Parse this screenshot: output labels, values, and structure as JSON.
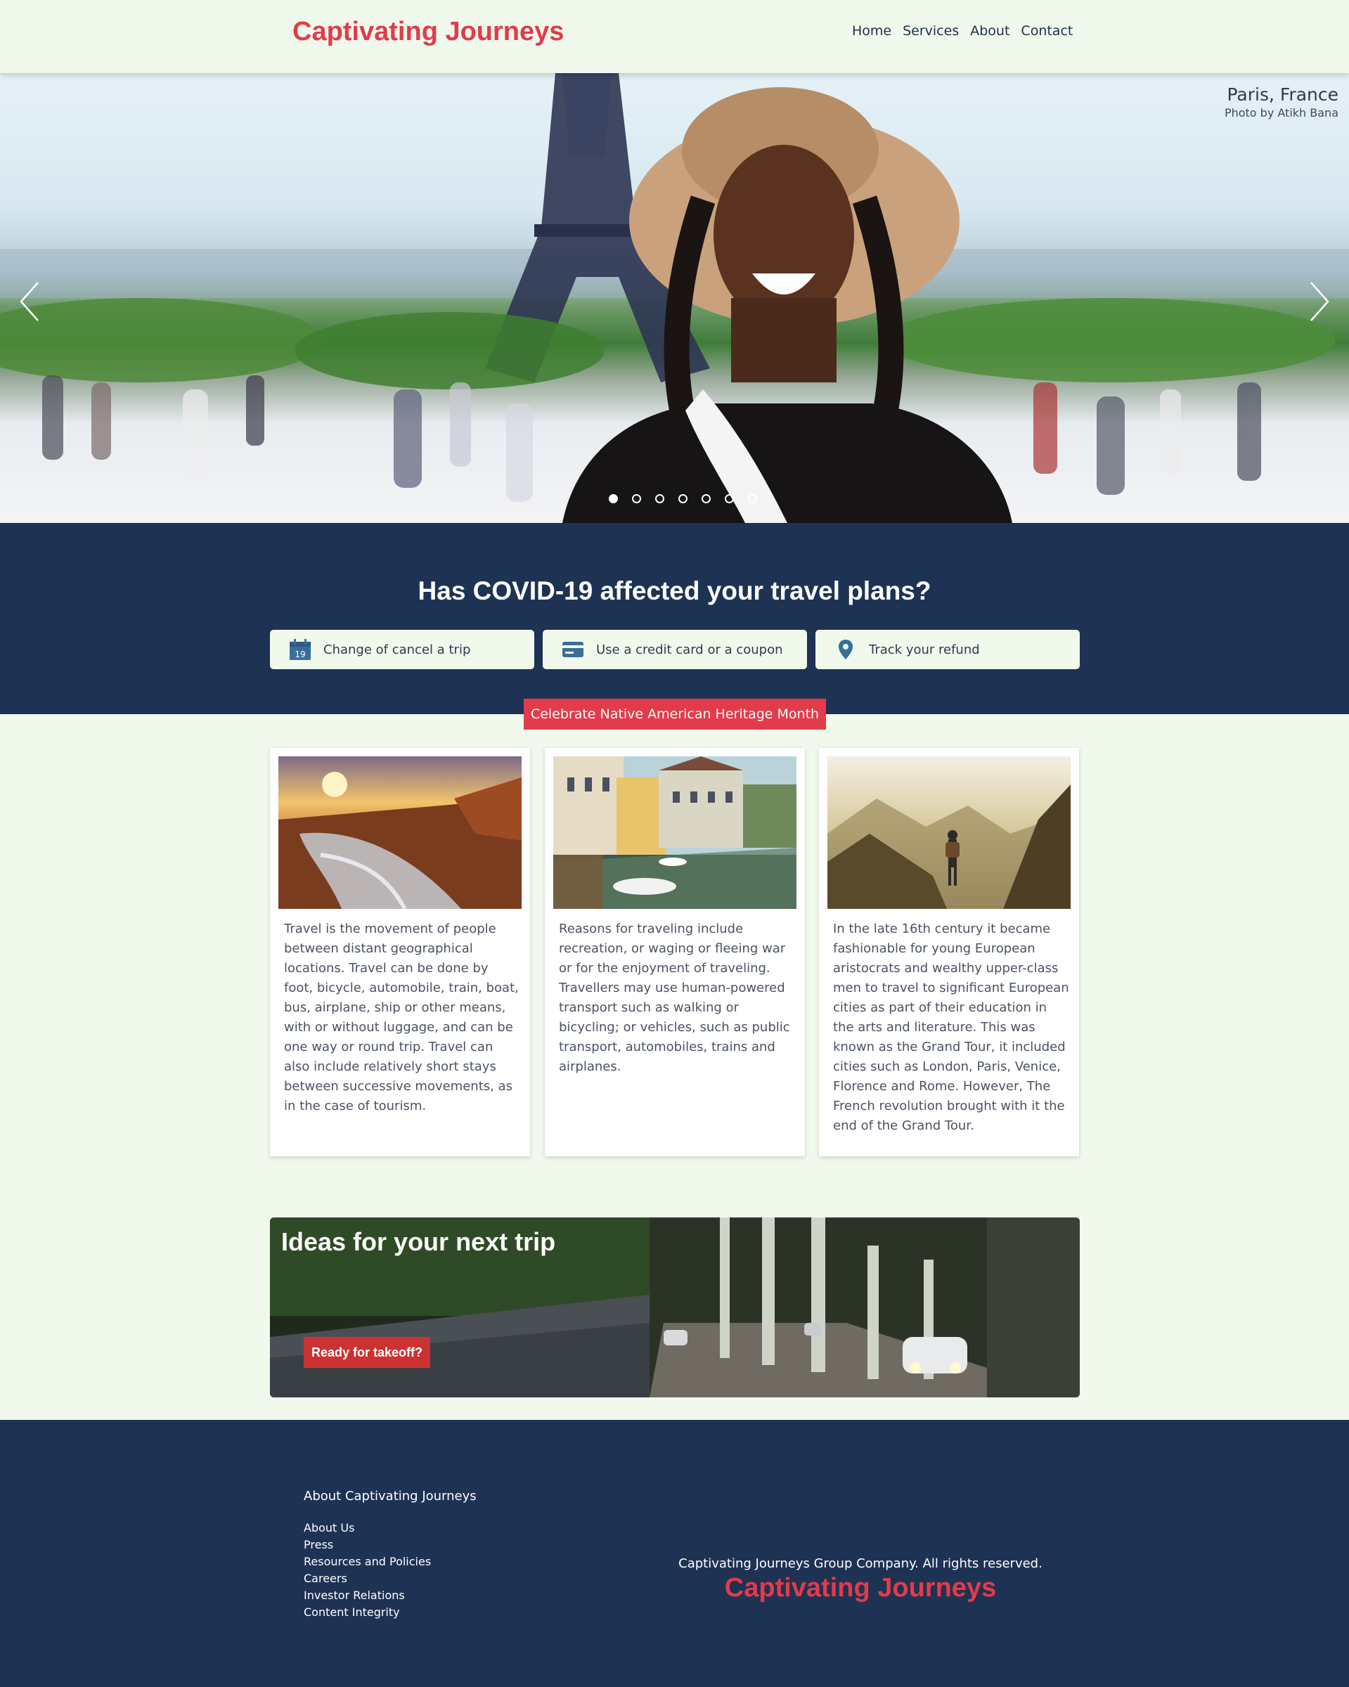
{
  "header": {
    "brand": "Captivating Journeys",
    "nav": [
      "Home",
      "Services",
      "About",
      "Contact"
    ]
  },
  "hero": {
    "place": "Paris, France",
    "credit": "Photo by Atikh Bana",
    "slide_count": 7,
    "active_slide": 1
  },
  "covid": {
    "title": "Has COVID-19 affected your travel plans?",
    "options": [
      {
        "icon": "calendar-icon",
        "label": "Change of cancel a trip",
        "calendar_day": "19"
      },
      {
        "icon": "credit-card-icon",
        "label": "Use a credit card or a coupon"
      },
      {
        "icon": "map-pin-icon",
        "label": "Track your refund"
      }
    ]
  },
  "badge": "Celebrate Native American Heritage Month",
  "cards": [
    {
      "text": "Travel is the movement of people between distant geographical locations. Travel can be done by foot, bicycle, automobile, train, boat, bus, airplane, ship or other means, with or without luggage, and can be one way or round trip. Travel can also include relatively short stays between successive movements, as in the case of tourism."
    },
    {
      "text": "Reasons for traveling include recreation, or waging or fleeing war or for the enjoyment of traveling. Travellers may use human-powered transport such as walking or bicycling; or vehicles, such as public transport, automobiles, trains and airplanes."
    },
    {
      "text": "In the late 16th century it became fashionable for young European aristocrats and wealthy upper-class men to travel to significant European cities as part of their education in the arts and literature. This was known as the Grand Tour, it included cities such as London, Paris, Venice, Florence and Rome. However, The French revolution brought with it the end of the Grand Tour."
    }
  ],
  "ideas": {
    "title": "Ideas for your next trip",
    "cta": "Ready for takeoff?"
  },
  "footer": {
    "heading": "About Captivating Journeys",
    "links": [
      "About Us",
      "Press",
      "Resources and Policies",
      "Careers",
      "Investor Relations",
      "Content Integrity"
    ],
    "copyright": "Captivating Journeys Group Company. All rights reserved.",
    "brand": "Captivating Journeys"
  },
  "colors": {
    "brand_red": "#e23b4a",
    "navy": "#1e3254",
    "mint_bg": "#f0f9ec",
    "cta_red": "#cd3232"
  }
}
